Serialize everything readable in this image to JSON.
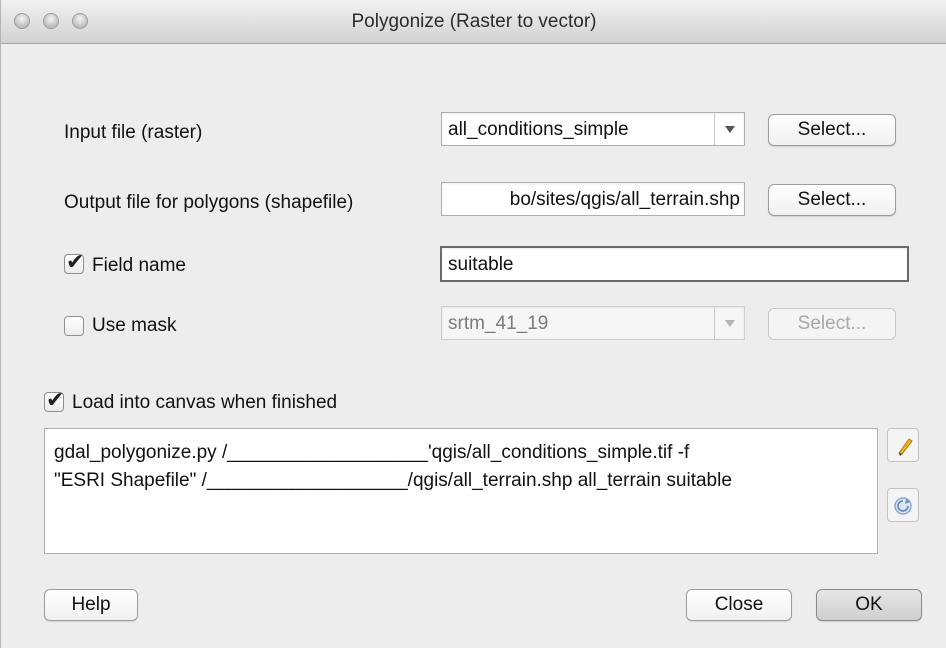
{
  "window": {
    "title": "Polygonize (Raster to vector)"
  },
  "input_file": {
    "label": "Input file (raster)",
    "value": "all_conditions_simple",
    "select_label": "Select..."
  },
  "output_file": {
    "label": "Output file for polygons (shapefile)",
    "value": "bo/sites/qgis/all_terrain.shp",
    "select_label": "Select..."
  },
  "field_name": {
    "label": "Field name",
    "checked": true,
    "value": "suitable"
  },
  "use_mask": {
    "label": "Use mask",
    "checked": false,
    "value": "srtm_41_19",
    "select_label": "Select..."
  },
  "load_canvas": {
    "label": "Load into canvas when finished",
    "checked": true
  },
  "command": {
    "line1": "gdal_polygonize.py /___________________'qgis/all_conditions_simple.tif -f",
    "line2": "\"ESRI Shapefile\" /___________________/qgis/all_terrain.shp all_terrain suitable"
  },
  "icons": {
    "edit": "pencil-icon",
    "reset": "refresh-icon"
  },
  "buttons": {
    "help": "Help",
    "close": "Close",
    "ok": "OK"
  }
}
